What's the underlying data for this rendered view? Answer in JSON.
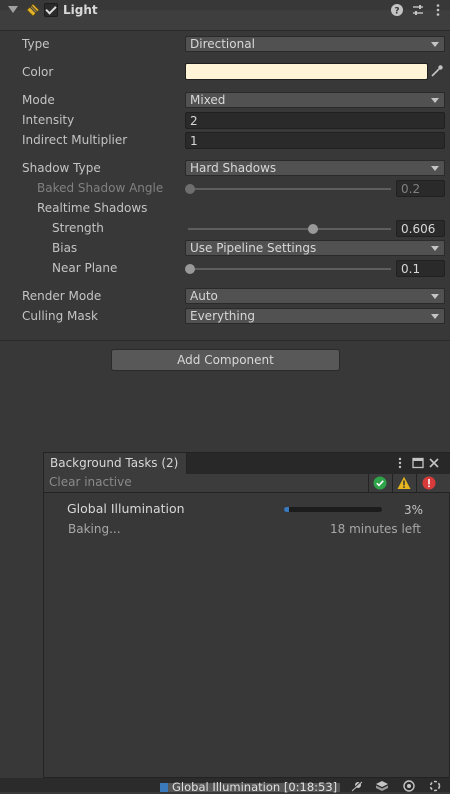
{
  "component": {
    "title": "Light",
    "enabled": true
  },
  "header_icons": [
    "help-icon",
    "preset-icon",
    "more-options-icon"
  ],
  "properties": {
    "type": {
      "label": "Type",
      "value": "Directional"
    },
    "color": {
      "label": "Color",
      "value": "#fff4d6"
    },
    "mode": {
      "label": "Mode",
      "value": "Mixed"
    },
    "intensity": {
      "label": "Intensity",
      "value": "2"
    },
    "indirect_multiplier": {
      "label": "Indirect Multiplier",
      "value": "1"
    },
    "shadow_type": {
      "label": "Shadow Type",
      "value": "Hard Shadows"
    },
    "baked_shadow_angle": {
      "label": "Baked Shadow Angle",
      "value": "0.2",
      "fraction": 0.0
    },
    "realtime_shadows": {
      "label": "Realtime Shadows"
    },
    "strength": {
      "label": "Strength",
      "value": "0.606",
      "fraction": 0.606
    },
    "bias": {
      "label": "Bias",
      "value": "Use Pipeline Settings"
    },
    "near_plane": {
      "label": "Near Plane",
      "value": "0.1",
      "fraction": 0.0
    },
    "render_mode": {
      "label": "Render Mode",
      "value": "Auto"
    },
    "culling_mask": {
      "label": "Culling Mask",
      "value": "Everything"
    }
  },
  "add_component_label": "Add Component",
  "background_tasks": {
    "tab_label": "Background Tasks (2)",
    "clear_inactive_label": "Clear inactive",
    "task": {
      "title": "Global Illumination",
      "percent_text": "3%",
      "progress": 0.03,
      "status": "Baking...",
      "time_left": "18 minutes left"
    }
  },
  "status_bar": {
    "text": "Global Illumination [0:18:53]",
    "progress": 0.03
  },
  "colors": {
    "accent": "#3a79bb",
    "success": "#2fa34a",
    "warning": "#e7b51f",
    "error": "#d93b3b"
  }
}
